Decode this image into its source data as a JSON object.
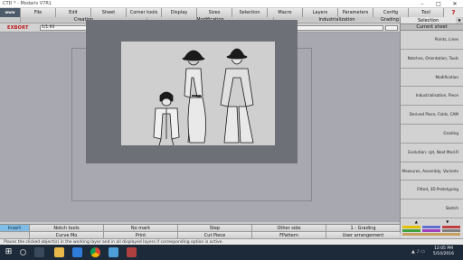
{
  "window": {
    "title": "CTD * - Modaris V7R1",
    "minimize": "–",
    "maximize": "□",
    "close": "✕"
  },
  "menubar": {
    "logo": "www",
    "items": [
      "File",
      "Edit",
      "Sheet",
      "Corner tools",
      "Display",
      "Sizes",
      "Selection",
      "Macro",
      "Layers",
      "Parameters",
      "Config",
      "Tool"
    ],
    "help": "?"
  },
  "subtabs": [
    "Creation",
    "Modification",
    "Industrialization",
    "Grading"
  ],
  "model_row": {
    "brand": "EXBORT",
    "size_value": "1/1.93",
    "field2": "",
    "field3": "",
    "field4": ""
  },
  "sidebar": {
    "selection_label": "Selection",
    "current_sheet": "Current sheet",
    "items": [
      "Points, Lines",
      "Notches, Orientation, Tools",
      "Modification",
      "Industrialisation, Piece",
      "Derived Piece, Folds, CAM",
      "Grading",
      "Evolution: cpt, Next Mod.R",
      "Measures, Assembly, Varients",
      "Fitted, 3D Prototyping",
      "Sketch"
    ],
    "scroll_up": "▲",
    "scroll_down": "▼"
  },
  "toolbar_row1": {
    "insert": "Insert",
    "items": [
      "Notch tools",
      "No mark",
      "Step",
      "Other side",
      "1 - Grading"
    ]
  },
  "toolbar_row2": {
    "items": [
      "Curve Mo",
      "Print",
      "Cut Piece",
      "FPattern",
      "User arrangement"
    ]
  },
  "statusbar": "Places the clicked object(s) in the working layer and in all displayed layers if corresponding option is active.",
  "taskbar": {
    "time": "12:05 PM",
    "date": "5/10/2016",
    "icons": [
      "windows-logo-icon",
      "search-icon",
      "task-view-icon",
      "file-explorer-icon",
      "edge-browser-icon",
      "chrome-icon",
      "app-icon",
      "app-icon-2"
    ]
  },
  "colors": {
    "brand_red": "#c01818",
    "insert_blue": "#7fbde6",
    "work_bg": "#a7a8b0",
    "taskbar": "#1d2a3a"
  }
}
